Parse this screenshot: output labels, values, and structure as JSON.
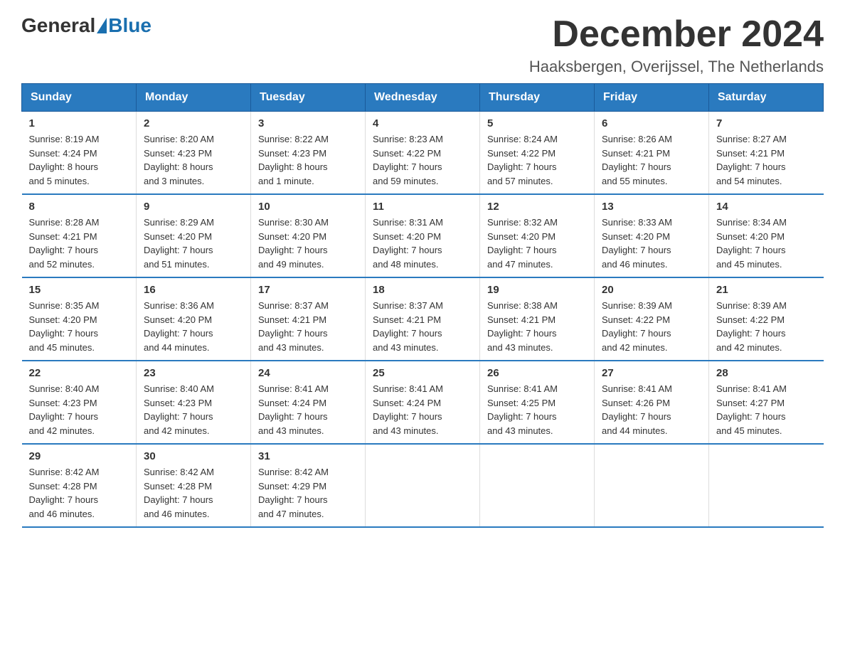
{
  "header": {
    "logo_general": "General",
    "logo_blue": "Blue",
    "month_title": "December 2024",
    "location": "Haaksbergen, Overijssel, The Netherlands"
  },
  "days_of_week": [
    "Sunday",
    "Monday",
    "Tuesday",
    "Wednesday",
    "Thursday",
    "Friday",
    "Saturday"
  ],
  "weeks": [
    [
      {
        "day": "1",
        "info": "Sunrise: 8:19 AM\nSunset: 4:24 PM\nDaylight: 8 hours\nand 5 minutes."
      },
      {
        "day": "2",
        "info": "Sunrise: 8:20 AM\nSunset: 4:23 PM\nDaylight: 8 hours\nand 3 minutes."
      },
      {
        "day": "3",
        "info": "Sunrise: 8:22 AM\nSunset: 4:23 PM\nDaylight: 8 hours\nand 1 minute."
      },
      {
        "day": "4",
        "info": "Sunrise: 8:23 AM\nSunset: 4:22 PM\nDaylight: 7 hours\nand 59 minutes."
      },
      {
        "day": "5",
        "info": "Sunrise: 8:24 AM\nSunset: 4:22 PM\nDaylight: 7 hours\nand 57 minutes."
      },
      {
        "day": "6",
        "info": "Sunrise: 8:26 AM\nSunset: 4:21 PM\nDaylight: 7 hours\nand 55 minutes."
      },
      {
        "day": "7",
        "info": "Sunrise: 8:27 AM\nSunset: 4:21 PM\nDaylight: 7 hours\nand 54 minutes."
      }
    ],
    [
      {
        "day": "8",
        "info": "Sunrise: 8:28 AM\nSunset: 4:21 PM\nDaylight: 7 hours\nand 52 minutes."
      },
      {
        "day": "9",
        "info": "Sunrise: 8:29 AM\nSunset: 4:20 PM\nDaylight: 7 hours\nand 51 minutes."
      },
      {
        "day": "10",
        "info": "Sunrise: 8:30 AM\nSunset: 4:20 PM\nDaylight: 7 hours\nand 49 minutes."
      },
      {
        "day": "11",
        "info": "Sunrise: 8:31 AM\nSunset: 4:20 PM\nDaylight: 7 hours\nand 48 minutes."
      },
      {
        "day": "12",
        "info": "Sunrise: 8:32 AM\nSunset: 4:20 PM\nDaylight: 7 hours\nand 47 minutes."
      },
      {
        "day": "13",
        "info": "Sunrise: 8:33 AM\nSunset: 4:20 PM\nDaylight: 7 hours\nand 46 minutes."
      },
      {
        "day": "14",
        "info": "Sunrise: 8:34 AM\nSunset: 4:20 PM\nDaylight: 7 hours\nand 45 minutes."
      }
    ],
    [
      {
        "day": "15",
        "info": "Sunrise: 8:35 AM\nSunset: 4:20 PM\nDaylight: 7 hours\nand 45 minutes."
      },
      {
        "day": "16",
        "info": "Sunrise: 8:36 AM\nSunset: 4:20 PM\nDaylight: 7 hours\nand 44 minutes."
      },
      {
        "day": "17",
        "info": "Sunrise: 8:37 AM\nSunset: 4:21 PM\nDaylight: 7 hours\nand 43 minutes."
      },
      {
        "day": "18",
        "info": "Sunrise: 8:37 AM\nSunset: 4:21 PM\nDaylight: 7 hours\nand 43 minutes."
      },
      {
        "day": "19",
        "info": "Sunrise: 8:38 AM\nSunset: 4:21 PM\nDaylight: 7 hours\nand 43 minutes."
      },
      {
        "day": "20",
        "info": "Sunrise: 8:39 AM\nSunset: 4:22 PM\nDaylight: 7 hours\nand 42 minutes."
      },
      {
        "day": "21",
        "info": "Sunrise: 8:39 AM\nSunset: 4:22 PM\nDaylight: 7 hours\nand 42 minutes."
      }
    ],
    [
      {
        "day": "22",
        "info": "Sunrise: 8:40 AM\nSunset: 4:23 PM\nDaylight: 7 hours\nand 42 minutes."
      },
      {
        "day": "23",
        "info": "Sunrise: 8:40 AM\nSunset: 4:23 PM\nDaylight: 7 hours\nand 42 minutes."
      },
      {
        "day": "24",
        "info": "Sunrise: 8:41 AM\nSunset: 4:24 PM\nDaylight: 7 hours\nand 43 minutes."
      },
      {
        "day": "25",
        "info": "Sunrise: 8:41 AM\nSunset: 4:24 PM\nDaylight: 7 hours\nand 43 minutes."
      },
      {
        "day": "26",
        "info": "Sunrise: 8:41 AM\nSunset: 4:25 PM\nDaylight: 7 hours\nand 43 minutes."
      },
      {
        "day": "27",
        "info": "Sunrise: 8:41 AM\nSunset: 4:26 PM\nDaylight: 7 hours\nand 44 minutes."
      },
      {
        "day": "28",
        "info": "Sunrise: 8:41 AM\nSunset: 4:27 PM\nDaylight: 7 hours\nand 45 minutes."
      }
    ],
    [
      {
        "day": "29",
        "info": "Sunrise: 8:42 AM\nSunset: 4:28 PM\nDaylight: 7 hours\nand 46 minutes."
      },
      {
        "day": "30",
        "info": "Sunrise: 8:42 AM\nSunset: 4:28 PM\nDaylight: 7 hours\nand 46 minutes."
      },
      {
        "day": "31",
        "info": "Sunrise: 8:42 AM\nSunset: 4:29 PM\nDaylight: 7 hours\nand 47 minutes."
      },
      {
        "day": "",
        "info": ""
      },
      {
        "day": "",
        "info": ""
      },
      {
        "day": "",
        "info": ""
      },
      {
        "day": "",
        "info": ""
      }
    ]
  ]
}
